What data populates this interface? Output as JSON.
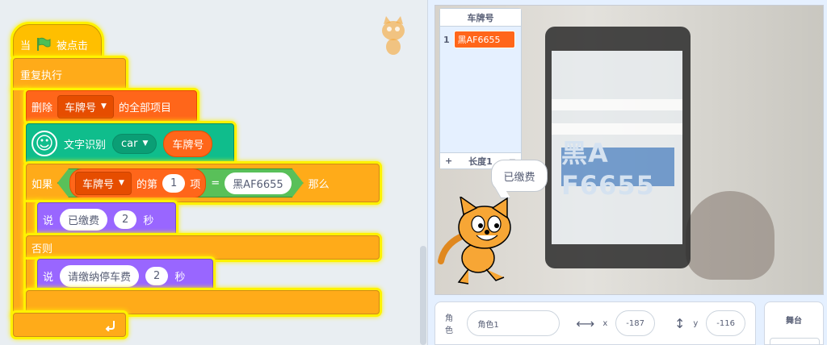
{
  "script": {
    "hat": {
      "prefix": "当",
      "suffix": "被点击",
      "flag_color": "#4cbf56"
    },
    "forever": {
      "label": "重复执行"
    },
    "delete_all": {
      "prefix": "删除",
      "list_name": "车牌号",
      "suffix": "的全部项目"
    },
    "ocr": {
      "label": "文字识别",
      "source": "car",
      "result": "车牌号"
    },
    "if_block": {
      "prefix": "如果",
      "list_name": "车牌号",
      "item_of": "的第",
      "index": "1",
      "item_suffix": "项",
      "equals": "=",
      "compare_value": "黑AF6655",
      "then": "那么",
      "else": "否则"
    },
    "say_paid": {
      "label": "说",
      "text": "已缴费",
      "secs": "2",
      "unit": "秒"
    },
    "say_pay": {
      "label": "说",
      "text": "请缴纳停车费",
      "secs": "2",
      "unit": "秒"
    }
  },
  "stage": {
    "list_monitor": {
      "title": "车牌号",
      "index": "1",
      "item": "黑AF6655",
      "add": "+",
      "length_label": "长度1",
      "resize": "="
    },
    "bubble_text": "已缴费",
    "plate_text": "黑A F6655"
  },
  "sprite_info": {
    "sprite_label": "角色",
    "sprite_name": "角色1",
    "x_label": "x",
    "x_value": "-187",
    "y_label": "y",
    "y_value": "-116"
  },
  "stage_pane": {
    "label": "舞台"
  },
  "colors": {
    "events": "#ffbf00",
    "control": "#ffab19",
    "list": "#ff661a",
    "extension": "#0fbd8c",
    "looks": "#9966ff",
    "operators": "#59c059",
    "highlight": "#fff200"
  }
}
